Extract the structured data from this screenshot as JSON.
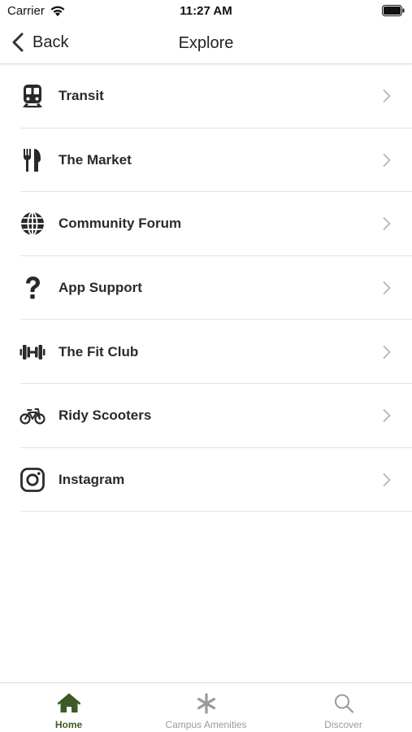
{
  "status_bar": {
    "carrier": "Carrier",
    "time": "11:27 AM"
  },
  "nav": {
    "back_label": "Back",
    "title": "Explore"
  },
  "items": [
    {
      "label": "Transit",
      "icon": "train-icon"
    },
    {
      "label": "The Market",
      "icon": "fork-knife-icon"
    },
    {
      "label": "Community Forum",
      "icon": "globe-icon"
    },
    {
      "label": "App Support",
      "icon": "question-icon"
    },
    {
      "label": "The Fit Club",
      "icon": "dumbbell-icon"
    },
    {
      "label": "Ridy Scooters",
      "icon": "bicycle-icon"
    },
    {
      "label": "Instagram",
      "icon": "instagram-icon"
    }
  ],
  "tabs": [
    {
      "label": "Home",
      "icon": "home-icon",
      "active": true
    },
    {
      "label": "Campus Amenities",
      "icon": "asterisk-icon",
      "active": false
    },
    {
      "label": "Discover",
      "icon": "search-icon",
      "active": false
    }
  ],
  "colors": {
    "accent": "#3e5a25",
    "inactive": "#9a9a9a",
    "icon": "#2a2a2a",
    "separator": "#e3e3e3"
  }
}
